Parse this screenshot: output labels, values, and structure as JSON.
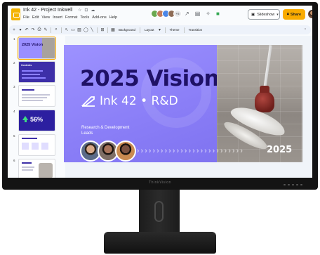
{
  "monitor": {
    "brand": "ThinkVision"
  },
  "app": {
    "doc_title": "Ink 42 - Project Inkwell",
    "menu": [
      "File",
      "Edit",
      "View",
      "Insert",
      "Format",
      "Tools",
      "Add-ons",
      "Help"
    ],
    "collaborators_extra": "+5",
    "slideshow_label": "Slideshow",
    "share_label": "Share"
  },
  "toolbar": {
    "background_label": "Background",
    "layout_label": "Layout",
    "theme_label": "Theme",
    "transition_label": "Transition"
  },
  "filmstrip": [
    {
      "num": "1",
      "label": "2025 Vision",
      "active": true
    },
    {
      "num": "2",
      "label": "Contents"
    },
    {
      "num": "3",
      "label": ""
    },
    {
      "num": "4",
      "label": "56%"
    },
    {
      "num": "5",
      "label": ""
    },
    {
      "num": "6",
      "label": ""
    }
  ],
  "slide": {
    "title": "2025 Vision",
    "brand_text": "Ink 42 • R&D",
    "subtitle": "Research & Development Leads",
    "year": "2025"
  },
  "colors": {
    "slide_purple": "#8f86ff",
    "title_navy": "#1f1166",
    "share_yellow": "#f9ab00",
    "app_logo": "#f4b400"
  }
}
